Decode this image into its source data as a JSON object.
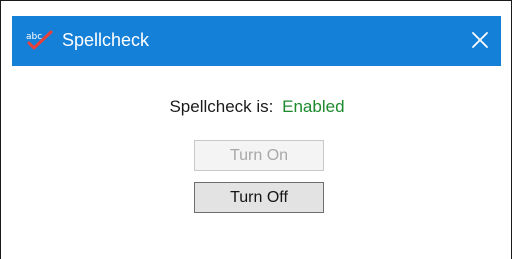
{
  "window": {
    "title": "Spellcheck",
    "icon": "spellcheck-abc-icon",
    "titlebar_color": "#1580d8",
    "close_icon": "close-icon"
  },
  "status": {
    "label": "Spellcheck is:",
    "value": "Enabled",
    "value_color": "#1d8a2e"
  },
  "buttons": {
    "turn_on": {
      "label": "Turn On",
      "enabled": false
    },
    "turn_off": {
      "label": "Turn Off",
      "enabled": true
    }
  }
}
